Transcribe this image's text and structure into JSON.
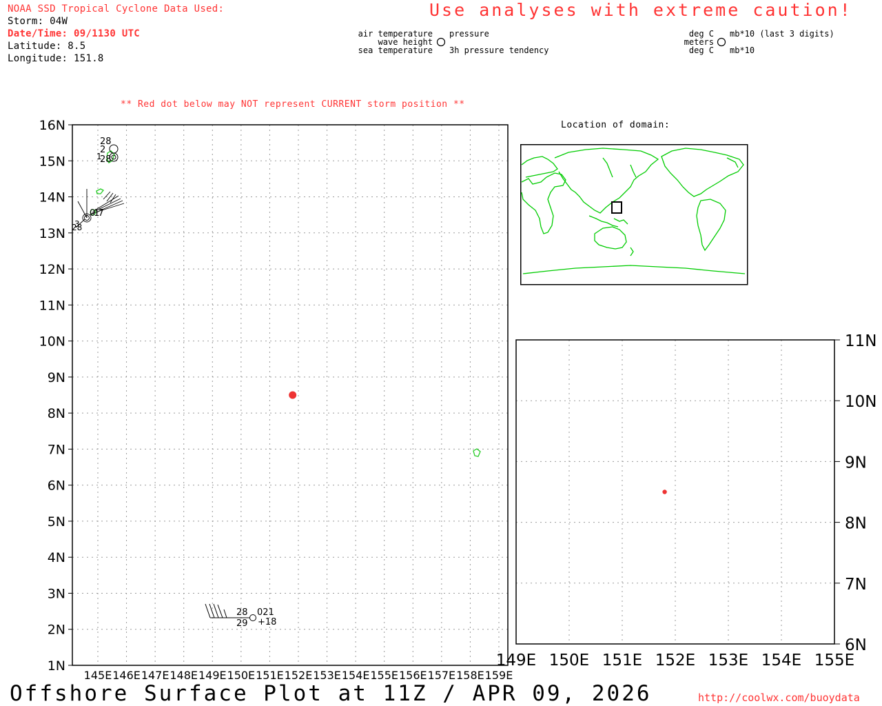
{
  "header": {
    "data_source": "NOAA SSD Tropical Cyclone Data Used:",
    "storm": "Storm: 04W",
    "datetime": "Date/Time: 09/1130 UTC",
    "latitude": "Latitude: 8.5",
    "longitude": "Longitude: 151.8",
    "caution": "Use analyses with extreme caution!"
  },
  "legend": {
    "left": {
      "air_temp": "air temperature",
      "wave_height": "wave height",
      "sea_temp": "sea temperature",
      "pressure": "pressure",
      "pressure_tendency": "3h pressure tendency"
    },
    "right": {
      "deg_c_top": "deg C",
      "meters": "meters",
      "deg_c_bottom": "deg C",
      "mb_last3": "mb*10 (last 3 digits)",
      "mb10": "mb*10"
    }
  },
  "warning": "** Red dot below may NOT represent CURRENT storm position **",
  "domain_label": "Location of domain:",
  "main_map": {
    "lat_labels": [
      "1N",
      "2N",
      "3N",
      "4N",
      "5N",
      "6N",
      "7N",
      "8N",
      "9N",
      "10N",
      "11N",
      "12N",
      "13N",
      "14N",
      "15N",
      "16N"
    ],
    "lon_labels": [
      "145E",
      "146E",
      "147E",
      "148E",
      "149E",
      "150E",
      "151E",
      "152E",
      "153E",
      "154E",
      "155E",
      "156E",
      "157E",
      "158E",
      "159E"
    ],
    "storm": {
      "lat": 8.5,
      "lon": 151.8
    },
    "stations": [
      {
        "air": "28",
        "sea": "29",
        "pressure": "021",
        "tendency": "+18"
      },
      {
        "air": "28",
        "sea": "28",
        "wave": "2",
        "extra": "1"
      },
      {
        "labels": [
          "3",
          "28",
          "017",
          "3"
        ]
      }
    ]
  },
  "zoom_map": {
    "lat_labels": [
      "6N",
      "7N",
      "8N",
      "9N",
      "10N",
      "11N"
    ],
    "lon_labels": [
      "149E",
      "150E",
      "151E",
      "152E",
      "153E",
      "154E",
      "155E"
    ],
    "storm": {
      "lat": 8.5,
      "lon": 151.8
    }
  },
  "footer": {
    "title": "Offshore Surface Plot at 11Z / APR 09, 2026",
    "url": "http://coolwx.com/buoydata"
  },
  "colors": {
    "storm_dot": "#ee3333",
    "coastline": "#00cc00",
    "header_red": "#ff3333"
  }
}
